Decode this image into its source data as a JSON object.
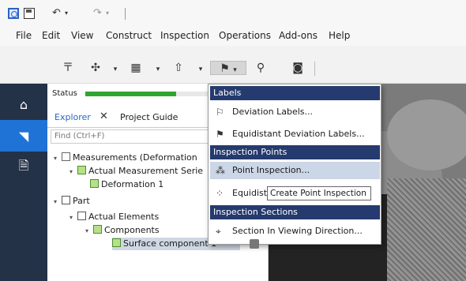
{
  "menubar": {
    "items": [
      "File",
      "Edit",
      "View",
      "Construct",
      "Inspection",
      "Operations",
      "Add-ons",
      "Help"
    ]
  },
  "toolbar": {
    "buttons": [
      "ruler-icon",
      "align-icon",
      "table-icon",
      "export-icon",
      "flag-icon",
      "search-icon",
      "camera-icon"
    ]
  },
  "left_nav": {
    "items": [
      "home-icon",
      "measurement-icon",
      "document-icon"
    ]
  },
  "panel": {
    "status_label": "Status",
    "status_progress": 0.72,
    "tabs": [
      "Explorer",
      "Project Guide"
    ],
    "tab_close": "✕",
    "find_placeholder": "Find (Ctrl+F)",
    "tree": [
      {
        "label": "Measurements (Deformation",
        "level": 0,
        "expanded": true
      },
      {
        "label": "Actual Measurement Serie",
        "level": 1,
        "expanded": true
      },
      {
        "label": "Deformation 1",
        "level": 2
      },
      {
        "label": "Part",
        "level": 0,
        "expanded": true
      },
      {
        "label": "Actual Elements",
        "level": 1,
        "expanded": true
      },
      {
        "label": "Components",
        "level": 2,
        "expanded": true
      },
      {
        "label": "Surface component 1",
        "level": 3,
        "selected": true
      }
    ]
  },
  "dropdown": {
    "sections": [
      {
        "header": "Labels",
        "items": [
          "Deviation Labels...",
          "Equidistant Deviation Labels..."
        ]
      },
      {
        "header": "Inspection Points",
        "items": [
          "Point Inspection...",
          "Equidista"
        ]
      },
      {
        "header": "Inspection Sections",
        "items": [
          "Section In Viewing Direction..."
        ]
      }
    ],
    "tooltip": "Create Point Inspection"
  },
  "colors": {
    "menu_header": "#253a6e",
    "nav_bg": "#243247",
    "nav_active": "#1f72d6",
    "status_green": "#2fa52f"
  }
}
